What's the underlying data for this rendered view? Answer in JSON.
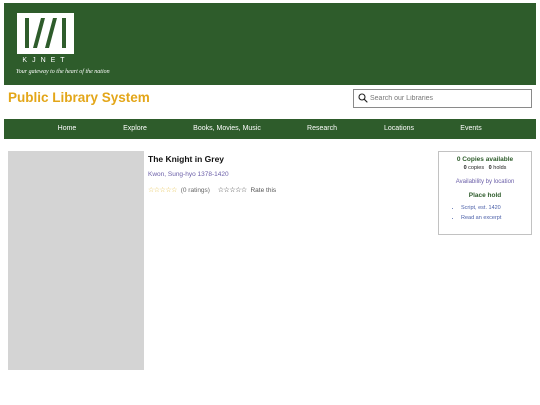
{
  "header": {
    "logo_word": "KJNET",
    "tagline": "Your gateway to the heart of the nation"
  },
  "site": {
    "title": "Public Library System"
  },
  "search": {
    "placeholder": "Search our Libraries"
  },
  "nav": {
    "items": [
      "Home",
      "Explore",
      "Books, Movies, Music",
      "Research",
      "Locations",
      "Events"
    ]
  },
  "book": {
    "title": "The Knight in Grey",
    "author": "Kwon, Sung-hyo 1378-1420",
    "ratings_text": "(0 ratings)",
    "rate_label": "Rate this",
    "average_rating": 0,
    "max_rating": 5
  },
  "availability": {
    "copies_available": "0 Copies available",
    "copies_count": "0",
    "copies_label": "copies",
    "holds_count": "0",
    "holds_label": "holds",
    "location_link": "Availability by location",
    "place_hold": "Place hold",
    "links": [
      "Script, est. 1420",
      "Read an excerpt"
    ]
  },
  "colors": {
    "brand_green": "#2e5c2b",
    "title_gold": "#e3a619",
    "link_purple": "#6b5fa8"
  },
  "icons": {
    "search": "search-icon",
    "logo": "kjnet-logo-icon"
  }
}
